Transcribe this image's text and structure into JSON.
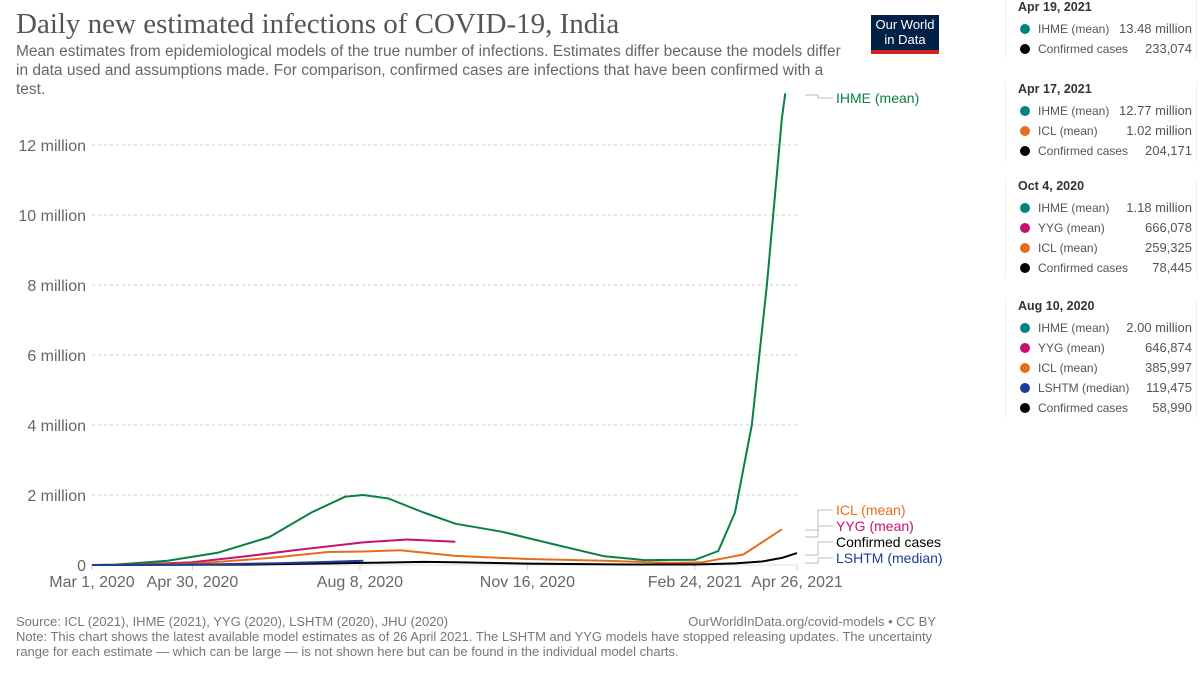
{
  "header": {
    "title": "Daily new estimated infections of COVID-19, India",
    "subtitle": "Mean estimates from epidemiological models of the true number of infections. Estimates differ because the models differ in data used and assumptions made. For comparison, confirmed cases are infections that have been confirmed with a test.",
    "logo_line1": "Our World",
    "logo_line2": "in Data"
  },
  "footer": {
    "source": "Source: ICL (2021), IHME (2021), YYG (2020), LSHTM (2020), JHU (2020)",
    "url": "OurWorldInData.org/covid-models • CC BY",
    "note": "Note: This chart shows the latest available model estimates as of 26 April 2021. The LSHTM and YYG models have stopped releasing updates. The uncertainty range for each estimate — which can be large — is not shown here but can be found in the individual model charts."
  },
  "tooltips": [
    {
      "date": "Apr 19, 2021",
      "rows": [
        {
          "name": "IHME (mean)",
          "value": "13.48 million",
          "color": "#00847e"
        },
        {
          "name": "Confirmed cases",
          "value": "233,074",
          "color": "#000000"
        }
      ]
    },
    {
      "date": "Apr 17, 2021",
      "rows": [
        {
          "name": "IHME (mean)",
          "value": "12.77 million",
          "color": "#00847e"
        },
        {
          "name": "ICL (mean)",
          "value": "1.02 million",
          "color": "#e56e1d"
        },
        {
          "name": "Confirmed cases",
          "value": "204,171",
          "color": "#000000"
        }
      ]
    },
    {
      "date": "Oct 4, 2020",
      "rows": [
        {
          "name": "IHME (mean)",
          "value": "1.18 million",
          "color": "#00847e"
        },
        {
          "name": "YYG (mean)",
          "value": "666,078",
          "color": "#c8126f"
        },
        {
          "name": "ICL (mean)",
          "value": "259,325",
          "color": "#e56e1d"
        },
        {
          "name": "Confirmed cases",
          "value": "78,445",
          "color": "#000000"
        }
      ]
    },
    {
      "date": "Aug 10, 2020",
      "rows": [
        {
          "name": "IHME (mean)",
          "value": "2.00 million",
          "color": "#00847e"
        },
        {
          "name": "YYG (mean)",
          "value": "646,874",
          "color": "#c8126f"
        },
        {
          "name": "ICL (mean)",
          "value": "385,997",
          "color": "#e56e1d"
        },
        {
          "name": "LSHTM (median)",
          "value": "119,475",
          "color": "#1d3d9c"
        },
        {
          "name": "Confirmed cases",
          "value": "58,990",
          "color": "#000000"
        }
      ]
    }
  ],
  "chart_data": {
    "type": "line",
    "title": "Daily new estimated infections of COVID-19, India",
    "xlabel": "",
    "ylabel": "",
    "x_domain": [
      "2020-03-01",
      "2021-04-26"
    ],
    "ylim": [
      0,
      13500000
    ],
    "grid": true,
    "y_ticks": [
      {
        "value": 0,
        "label": "0"
      },
      {
        "value": 2000000,
        "label": "2 million"
      },
      {
        "value": 4000000,
        "label": "4 million"
      },
      {
        "value": 6000000,
        "label": "6 million"
      },
      {
        "value": 8000000,
        "label": "8 million"
      },
      {
        "value": 10000000,
        "label": "10 million"
      },
      {
        "value": 12000000,
        "label": "12 million"
      }
    ],
    "x_ticks": [
      {
        "date": "2020-03-01",
        "label": "Mar 1, 2020"
      },
      {
        "date": "2020-04-30",
        "label": "Apr 30, 2020"
      },
      {
        "date": "2020-08-08",
        "label": "Aug 8, 2020"
      },
      {
        "date": "2020-11-16",
        "label": "Nov 16, 2020"
      },
      {
        "date": "2021-02-24",
        "label": "Feb 24, 2021"
      },
      {
        "date": "2021-04-26",
        "label": "Apr 26, 2021"
      }
    ],
    "legend": "right-inline",
    "series": [
      {
        "name": "IHME (mean)",
        "color": "#0b8042",
        "points": [
          [
            "2020-03-15",
            10000
          ],
          [
            "2020-04-15",
            120000
          ],
          [
            "2020-05-15",
            350000
          ],
          [
            "2020-06-15",
            800000
          ],
          [
            "2020-07-10",
            1500000
          ],
          [
            "2020-07-30",
            1950000
          ],
          [
            "2020-08-10",
            2000000
          ],
          [
            "2020-08-25",
            1900000
          ],
          [
            "2020-09-15",
            1500000
          ],
          [
            "2020-10-04",
            1180000
          ],
          [
            "2020-11-01",
            950000
          ],
          [
            "2020-12-01",
            600000
          ],
          [
            "2021-01-01",
            250000
          ],
          [
            "2021-01-25",
            140000
          ],
          [
            "2021-02-24",
            150000
          ],
          [
            "2021-03-10",
            400000
          ],
          [
            "2021-03-20",
            1500000
          ],
          [
            "2021-03-30",
            4000000
          ],
          [
            "2021-04-08",
            8000000
          ],
          [
            "2021-04-17",
            12770000
          ],
          [
            "2021-04-19",
            13480000
          ]
        ]
      },
      {
        "name": "YYG (mean)",
        "color": "#c8126f",
        "points": [
          [
            "2020-03-20",
            0
          ],
          [
            "2020-04-30",
            80000
          ],
          [
            "2020-06-01",
            250000
          ],
          [
            "2020-07-01",
            430000
          ],
          [
            "2020-08-10",
            646874
          ],
          [
            "2020-09-05",
            730000
          ],
          [
            "2020-10-04",
            666078
          ]
        ]
      },
      {
        "name": "ICL (mean)",
        "color": "#e56e1d",
        "points": [
          [
            "2020-03-01",
            0
          ],
          [
            "2020-05-01",
            40000
          ],
          [
            "2020-06-15",
            200000
          ],
          [
            "2020-07-20",
            370000
          ],
          [
            "2020-08-10",
            385997
          ],
          [
            "2020-09-01",
            420000
          ],
          [
            "2020-10-04",
            259325
          ],
          [
            "2020-11-16",
            170000
          ],
          [
            "2021-01-01",
            120000
          ],
          [
            "2021-02-10",
            60000
          ],
          [
            "2021-03-01",
            80000
          ],
          [
            "2021-03-25",
            300000
          ],
          [
            "2021-04-17",
            1020000
          ]
        ]
      },
      {
        "name": "Confirmed cases",
        "color": "#000000",
        "points": [
          [
            "2020-03-01",
            0
          ],
          [
            "2020-06-01",
            10000
          ],
          [
            "2020-08-10",
            58990
          ],
          [
            "2020-09-15",
            90000
          ],
          [
            "2020-10-04",
            78445
          ],
          [
            "2020-11-16",
            40000
          ],
          [
            "2021-01-15",
            15000
          ],
          [
            "2021-02-24",
            15000
          ],
          [
            "2021-03-20",
            45000
          ],
          [
            "2021-04-05",
            100000
          ],
          [
            "2021-04-17",
            204171
          ],
          [
            "2021-04-19",
            233074
          ],
          [
            "2021-04-26",
            340000
          ]
        ]
      },
      {
        "name": "LSHTM (median)",
        "color": "#1d3d9c",
        "points": [
          [
            "2020-03-01",
            0
          ],
          [
            "2020-05-01",
            10000
          ],
          [
            "2020-06-20",
            50000
          ],
          [
            "2020-07-20",
            90000
          ],
          [
            "2020-08-10",
            119475
          ]
        ]
      }
    ]
  }
}
